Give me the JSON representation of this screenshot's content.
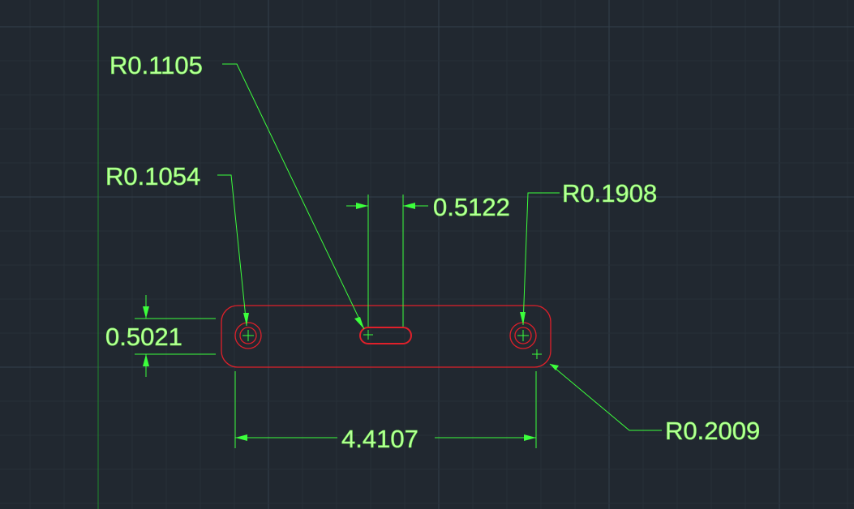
{
  "colors": {
    "background": "#212830",
    "grid_major": "#34404b",
    "grid_minor": "#283038",
    "axis": "#1f8a2c",
    "geometry": "#e0202a",
    "dimension": "#3cff3c",
    "text": "#b9ff9a"
  },
  "dimensions": {
    "slot_radius": "R0.1105",
    "left_hole_radius": "R0.1054",
    "slot_width": "0.5122",
    "right_hole_radius": "R0.1908",
    "part_height": "0.5021",
    "part_length": "4.4107",
    "corner_radius": "R0.2009"
  }
}
